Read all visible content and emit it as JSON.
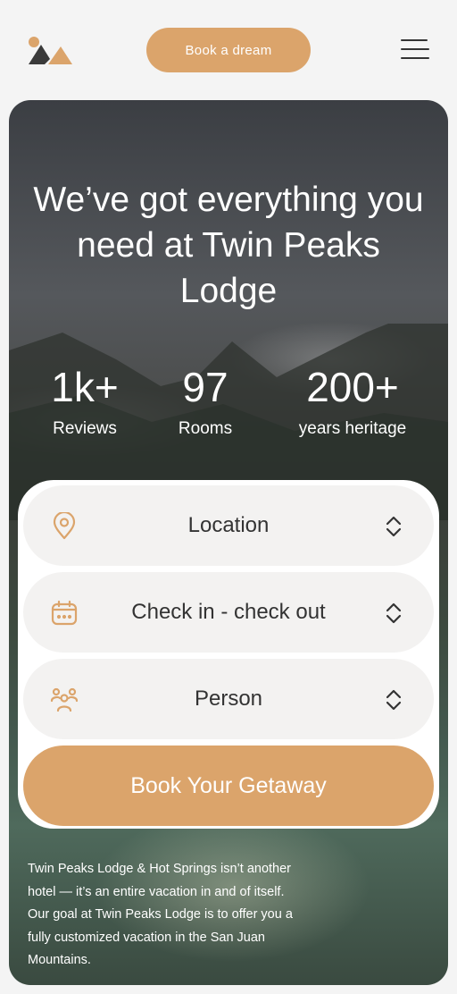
{
  "header": {
    "cta_label": "Book a dream"
  },
  "hero": {
    "title": "We’ve got everything you need at Twin Peaks Lodge",
    "stats": [
      {
        "value": "1k+",
        "label": "Reviews"
      },
      {
        "value": "97",
        "label": "Rooms"
      },
      {
        "value": "200+",
        "label": "years heritage"
      }
    ]
  },
  "booking": {
    "fields": [
      {
        "label": "Location",
        "icon": "location-pin-icon"
      },
      {
        "label": "Check in - check out",
        "icon": "calendar-icon"
      },
      {
        "label": "Person",
        "icon": "people-icon"
      }
    ],
    "submit_label": "Book Your Getaway"
  },
  "description": "Twin Peaks Lodge & Hot Springs isn’t another hotel — it’s an entire vacation in and of itself. Our goal at Twin Peaks Lodge is to offer you a fully customized vacation in the San Juan Mountains.",
  "colors": {
    "accent": "#dba46b",
    "logo_dark": "#3a3a3a",
    "field_bg": "#f3f2f1"
  }
}
